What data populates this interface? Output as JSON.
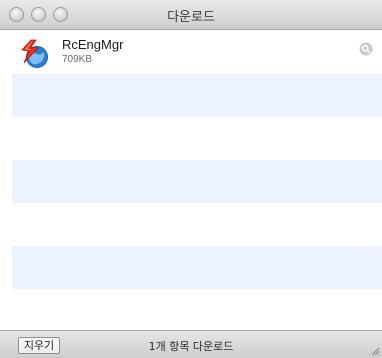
{
  "window": {
    "title": "다운로드"
  },
  "downloads": [
    {
      "name": "RcEngMgr",
      "size": "709KB",
      "icon": "rcengmgr-app-icon",
      "action_icon": "magnifier-icon"
    }
  ],
  "footer": {
    "clear_label": "지우기",
    "status": "1개 항목 다운로드"
  }
}
